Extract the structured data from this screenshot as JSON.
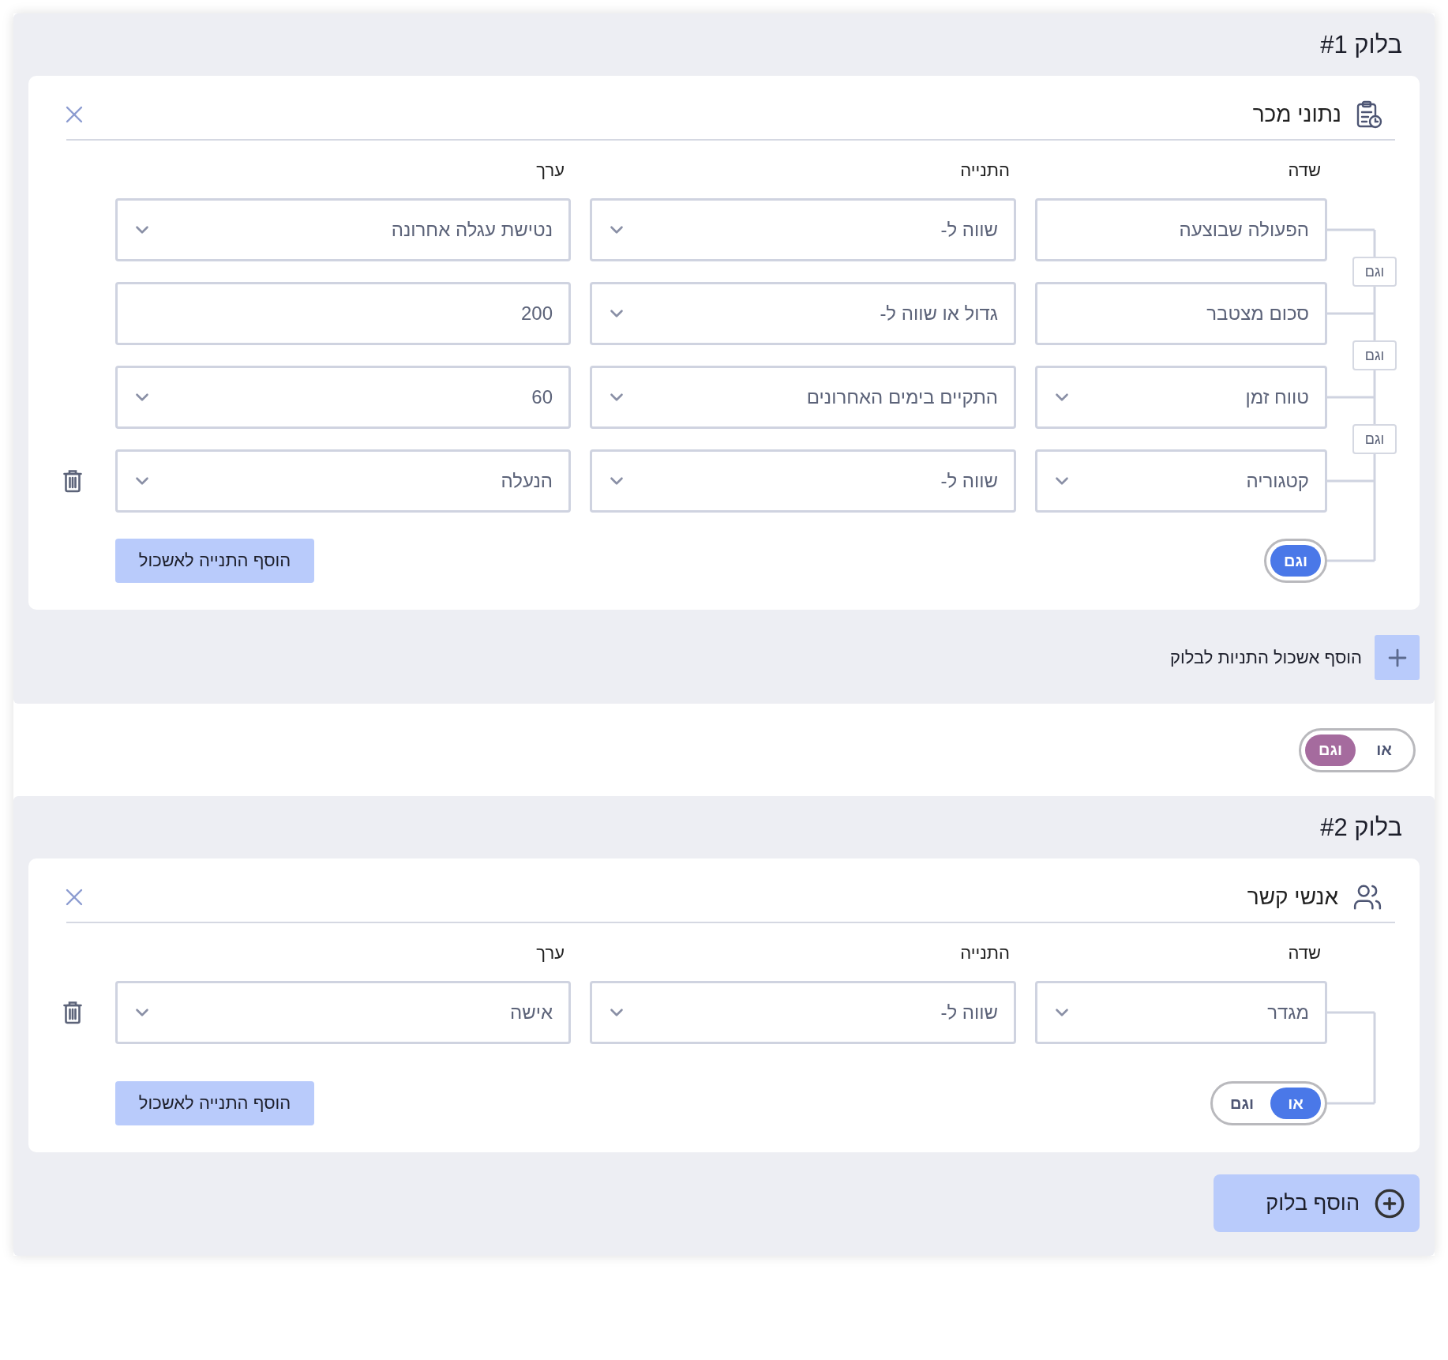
{
  "blocks": [
    {
      "title": "בלוק #1",
      "clusters": [
        {
          "kind": "clipboard",
          "title": "נתוני מכר",
          "columns": [
            "שדה",
            "התנייה",
            "ערך"
          ],
          "rows": [
            {
              "cells": [
                {
                  "kind": "input",
                  "text": "הפעולה שבוצעה"
                },
                {
                  "kind": "select",
                  "text": "שווה ל-"
                },
                {
                  "kind": "select",
                  "text": "נטישת עגלה אחרונה"
                }
              ],
              "deletable": false
            },
            {
              "cells": [
                {
                  "kind": "input",
                  "text": "סכום מצטבר"
                },
                {
                  "kind": "select",
                  "text": "גדול או שווה ל-"
                },
                {
                  "kind": "input",
                  "text": "200"
                }
              ],
              "deletable": false
            },
            {
              "cells": [
                {
                  "kind": "select",
                  "text": "טווח זמן"
                },
                {
                  "kind": "select",
                  "text": "התקיים בימים האחרונים"
                },
                {
                  "kind": "select",
                  "text": "60"
                }
              ],
              "deletable": false
            },
            {
              "cells": [
                {
                  "kind": "select",
                  "text": "קטגוריה"
                },
                {
                  "kind": "select",
                  "text": "שווה ל-"
                },
                {
                  "kind": "select",
                  "text": "הנעלה"
                }
              ],
              "deletable": true
            }
          ],
          "joins": [
            "וגם",
            "וגם",
            "וגם"
          ],
          "toggle": [
            {
              "label": "וגם",
              "selected": true
            }
          ],
          "add_condition": "הוסף התנייה לאשכול"
        }
      ],
      "add_cluster": "הוסף אשכול התניות לבלוק"
    },
    {
      "title": "בלוק #2",
      "clusters": [
        {
          "kind": "people",
          "title": "אנשי קשר",
          "columns": [
            "שדה",
            "התנייה",
            "ערך"
          ],
          "rows": [
            {
              "cells": [
                {
                  "kind": "select",
                  "text": "מגדר"
                },
                {
                  "kind": "select",
                  "text": "שווה ל-"
                },
                {
                  "kind": "select",
                  "text": "אישה"
                }
              ],
              "deletable": true
            }
          ],
          "toggle": [
            {
              "label": "או",
              "selected": true
            },
            {
              "label": "וגם",
              "selected": false
            }
          ],
          "add_condition": "הוסף התנייה לאשכול"
        }
      ],
      "add_block": "הוסף בלוק"
    }
  ],
  "block_join": [
    {
      "label": "או",
      "selected": false
    },
    {
      "label": "וגם",
      "selected": true
    }
  ]
}
